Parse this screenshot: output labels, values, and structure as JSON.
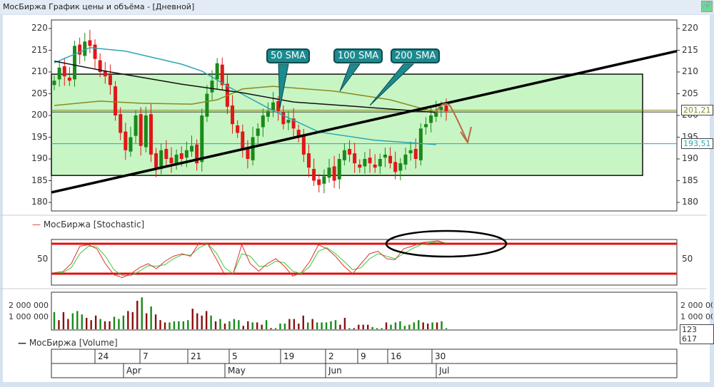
{
  "window": {
    "title": "МосБиржа График цены и объёма - [Дневной]",
    "link_icon": "link-icon"
  },
  "chart_data": [
    {
      "type": "candlestick",
      "title": "МосБиржа",
      "ylim": [
        180,
        220
      ],
      "yticks": [
        220,
        215,
        210,
        205,
        200,
        195,
        190,
        185,
        180
      ],
      "closes": [
        208,
        211,
        209,
        208,
        216,
        214,
        217,
        216,
        213,
        210,
        209,
        207,
        200,
        196,
        192,
        195,
        200,
        193,
        200,
        191,
        188,
        192,
        190,
        189,
        191,
        190,
        192,
        193,
        189,
        200,
        205,
        208,
        212,
        207,
        202,
        198,
        196,
        192,
        190,
        195,
        197,
        200,
        201,
        203,
        201,
        198,
        199,
        197,
        195,
        191,
        188,
        185,
        184,
        186,
        188,
        185,
        190,
        192,
        191,
        189,
        188,
        190,
        189,
        188,
        190,
        191,
        189,
        187,
        189,
        191,
        192,
        190,
        197,
        198,
        200,
        201,
        202,
        201
      ],
      "sma": [
        {
          "name": "50 SMA",
          "color": "#2aa7b5",
          "points": [
            [
              0,
              212.1
            ],
            [
              7,
              215.6
            ],
            [
              14,
              214.8
            ],
            [
              25,
              211.8
            ],
            [
              29,
              210.2
            ],
            [
              35,
              206.1
            ],
            [
              43,
              201.1
            ],
            [
              52,
              196.2
            ],
            [
              63,
              194.3
            ],
            [
              75,
              193.3
            ]
          ]
        },
        {
          "name": "100 SMA",
          "color": "#8a8a20",
          "points": [
            [
              0,
              202.3
            ],
            [
              9,
              203.3
            ],
            [
              17,
              202.8
            ],
            [
              27,
              202.6
            ],
            [
              32,
              203.6
            ],
            [
              37,
              206.1
            ],
            [
              43,
              206.7
            ],
            [
              55,
              205.6
            ],
            [
              66,
              203.6
            ],
            [
              75,
              200.7
            ]
          ]
        },
        {
          "name": "200 SMA",
          "color": "#111111",
          "points": [
            [
              0,
              212.5
            ],
            [
              10,
              210.2
            ],
            [
              25,
              207.2
            ],
            [
              37,
              205.2
            ],
            [
              47,
              203.1
            ],
            [
              60,
              202
            ],
            [
              75,
              200.7
            ]
          ]
        }
      ],
      "callouts": [
        "50 SMA",
        "100 SMA",
        "200 SMA"
      ],
      "levels": [
        {
          "value": "201,21",
          "color": "#8a8a20"
        },
        {
          "value": "193,51",
          "color": "#2aa7b5"
        }
      ],
      "trendline": [
        182.3,
        214.8
      ],
      "range_box": [
        186.2,
        209.5
      ]
    },
    {
      "type": "line",
      "title": "МосБиржа [Stochastic]",
      "ylim": [
        0,
        100
      ],
      "yticks": [
        50
      ],
      "bands": [
        80,
        20
      ],
      "k": [
        22,
        24,
        40,
        75,
        78,
        70,
        40,
        18,
        12,
        20,
        32,
        40,
        30,
        45,
        55,
        60,
        55,
        82,
        80,
        50,
        18,
        20,
        78,
        40,
        25,
        40,
        50,
        35,
        15,
        22,
        45,
        78,
        70,
        55,
        35,
        20,
        40,
        60,
        65,
        50,
        48,
        70,
        75,
        82,
        84,
        86,
        80
      ],
      "d": [
        22,
        22,
        32,
        60,
        75,
        74,
        55,
        28,
        16,
        16,
        25,
        36,
        35,
        38,
        50,
        58,
        57,
        72,
        80,
        62,
        32,
        20,
        60,
        55,
        35,
        35,
        45,
        42,
        25,
        20,
        35,
        65,
        72,
        60,
        45,
        28,
        32,
        50,
        60,
        55,
        50,
        60,
        70,
        78,
        82,
        84,
        82
      ]
    },
    {
      "type": "bar",
      "title": "МосБиржа [Volume]",
      "yticks": [
        "2 000 000",
        "1 000 000"
      ],
      "last_value": "123 617",
      "values_millions": [
        1.5,
        0.8,
        1.5,
        0.9,
        1.4,
        1.6,
        1.3,
        1.0,
        0.8,
        1.2,
        0.9,
        0.7,
        0.7,
        1.1,
        0.9,
        1.2,
        1.6,
        1.5,
        2.5,
        2.8,
        1.4,
        2.0,
        1.3,
        0.8,
        0.6,
        0.6,
        0.7,
        0.7,
        0.7,
        0.8,
        1.8,
        1.4,
        1.2,
        1.6,
        1.2,
        0.7,
        0.9,
        0.5,
        0.7,
        0.9,
        0.8,
        0.3,
        0.7,
        0.6,
        0.6,
        0.4,
        0.8,
        0.1,
        0.1,
        0.5,
        0.5,
        0.9,
        0.9,
        0.5,
        1.2,
        0.6,
        0.9,
        0.6,
        0.6,
        0.6,
        0.7,
        0.8,
        0.4,
        1.0,
        0.1,
        0.1,
        0.4,
        0.4,
        0.4,
        0.2,
        0.1,
        0.1,
        0.6,
        0.4,
        0.6,
        0.7,
        0.3,
        0.4,
        0.6,
        0.8,
        0.6,
        0.5,
        0.6,
        0.6,
        0.7,
        0.1
      ],
      "up": "gr rgggrrrgrrgggrrrgrgrrrgggggrrrrgrgrgggrrgrrgrgggrrrrgrgggggrrgrrrrgggrgggggggrrgrgg"
    }
  ],
  "date_axis": {
    "days": [
      "24",
      "7",
      "21",
      "5",
      "19",
      "2",
      "9",
      "16",
      "30"
    ],
    "months": [
      "Apr",
      "May",
      "Jun",
      "Jul"
    ]
  }
}
